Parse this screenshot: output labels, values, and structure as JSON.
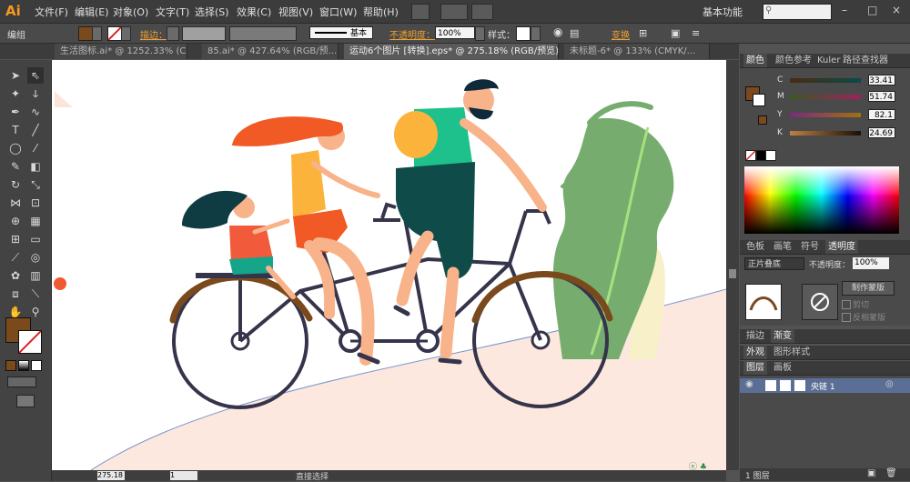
{
  "app": {
    "logo": "Ai"
  },
  "menu": [
    "文件(F)",
    "编辑(E)",
    "对象(O)",
    "文字(T)",
    "选择(S)",
    "效果(C)",
    "视图(V)",
    "窗口(W)",
    "帮助(H)"
  ],
  "workspace": "基本功能",
  "window_controls": {
    "minimize": "–",
    "maximize": "□",
    "close": "×"
  },
  "control_bar": {
    "group_label": "编组",
    "stroke_label": "描边：",
    "stroke_style": "基本",
    "opacity_label": "不透明度：",
    "opacity_value": "100%",
    "style_label": "样式：",
    "transform_label": "变换"
  },
  "tabs": [
    {
      "label": "生活图标.ai* @ 1252.33% (C...",
      "close": "×"
    },
    {
      "label": "85.ai* @ 427.64% (RGB/预...",
      "close": "×"
    },
    {
      "label": "运动6个图片 [转换].eps* @ 275.18% (RGB/预览)",
      "close": "×"
    },
    {
      "label": "未标题-6* @ 133% (CMYK/...",
      "close": "×"
    }
  ],
  "color_panel": {
    "tabs": [
      "颜色",
      "颜色参考",
      "Kuler",
      "路径查找器"
    ],
    "channels": [
      {
        "name": "C",
        "value": "33.41"
      },
      {
        "name": "M",
        "value": "51.74"
      },
      {
        "name": "Y",
        "value": "82.1"
      },
      {
        "name": "K",
        "value": "24.69"
      }
    ]
  },
  "transparency_panel": {
    "tabs": [
      "色板",
      "画笔",
      "符号",
      "透明度"
    ],
    "blend_mode": "正片叠底",
    "opacity_label": "不透明度：",
    "opacity_value": "100%",
    "make_mask_button": "制作蒙版",
    "clip_label": "剪切",
    "invert_label": "反相蒙版"
  },
  "stroke_gradient_tabs": [
    "描边",
    "渐变"
  ],
  "appearance_tabs": [
    "外观",
    "图形样式"
  ],
  "layers_panel": {
    "tabs": [
      "图层",
      "画板"
    ],
    "layer_name": "央链 1",
    "footer": "1 图层"
  },
  "status_bar": {
    "zoom": "275.18",
    "page": "1",
    "tool_info": "直接选择"
  },
  "colors": {
    "fill": "#7a4a1d",
    "accent": "#f79a1e"
  }
}
